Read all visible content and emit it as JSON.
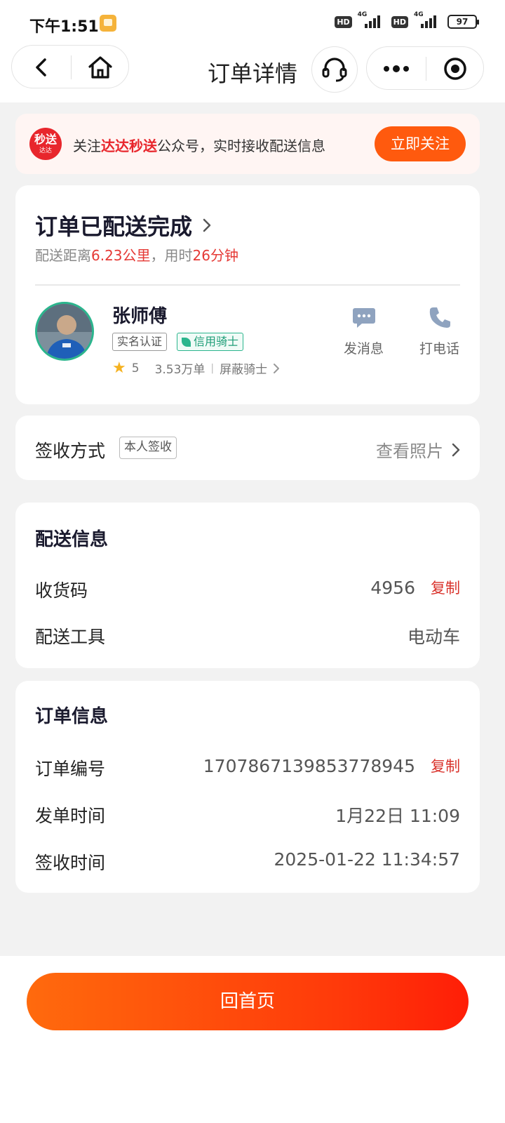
{
  "status_bar": {
    "time": "下午1:51",
    "hd1": "HD",
    "net1": "4G",
    "hd2": "HD",
    "net2": "4G",
    "battery": "97"
  },
  "nav": {
    "title": "订单详情"
  },
  "banner": {
    "logo_main": "秒送",
    "logo_sub": "达达",
    "text_prefix": "关注",
    "text_highlight": "达达秒送",
    "text_suffix": "公众号，实时接收配送信息",
    "button": "立即关注"
  },
  "status_card": {
    "title": "订单已配送完成",
    "dist_prefix": "配送距离",
    "distance": "6.23公里",
    "time_prefix": "，用时",
    "duration": "26分钟"
  },
  "rider": {
    "name": "张师傅",
    "tag_real": "实名认证",
    "tag_credit": "信用骑士",
    "rating": "5",
    "orders": "3.53万单",
    "block": "屏蔽骑士",
    "message_label": "发消息",
    "call_label": "打电话"
  },
  "sign": {
    "label": "签收方式",
    "tag": "本人签收",
    "view_photo": "查看照片"
  },
  "delivery_info": {
    "title": "配送信息",
    "rows": [
      {
        "label": "收货码",
        "value": "4956",
        "action": "复制"
      },
      {
        "label": "配送工具",
        "value": "电动车"
      }
    ]
  },
  "order_info": {
    "title": "订单信息",
    "rows": [
      {
        "label": "订单编号",
        "value": "1707867139853778945",
        "action": "复制"
      },
      {
        "label": "发单时间",
        "value": "1月22日 11:09"
      },
      {
        "label": "签收时间",
        "value": "2025-01-22 11:34:57"
      }
    ]
  },
  "bottom": {
    "home_button": "回首页"
  },
  "colors": {
    "accent_orange": "#ff5a0e",
    "highlight_red": "#e53935",
    "credit_green": "#2bb58d",
    "star_yellow": "#f5b221"
  },
  "icons": [
    "back-icon",
    "home-icon",
    "headset-icon",
    "more-icon",
    "record-icon",
    "chat-icon",
    "phone-icon",
    "star-icon",
    "chevron-right-icon",
    "leaf-icon"
  ]
}
